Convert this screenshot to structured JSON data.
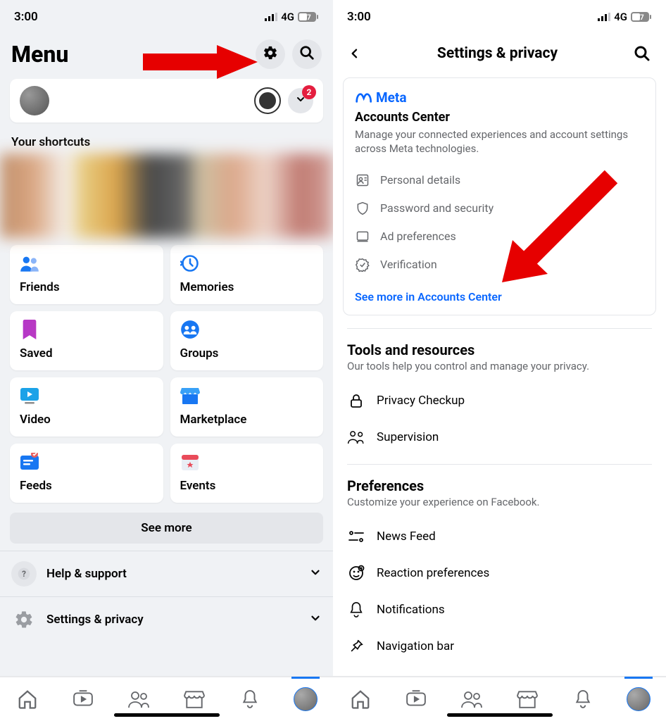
{
  "status": {
    "time": "3:00",
    "network": "4G",
    "battery": "47"
  },
  "left": {
    "title": "Menu",
    "notif_badge": "2",
    "shortcuts_label": "Your shortcuts",
    "tiles": [
      {
        "label": "Friends"
      },
      {
        "label": "Memories"
      },
      {
        "label": "Saved"
      },
      {
        "label": "Groups"
      },
      {
        "label": "Video"
      },
      {
        "label": "Marketplace"
      },
      {
        "label": "Feeds"
      },
      {
        "label": "Events"
      }
    ],
    "see_more": "See more",
    "menu": [
      {
        "label": "Help & support"
      },
      {
        "label": "Settings & privacy"
      }
    ]
  },
  "right": {
    "title": "Settings & privacy",
    "meta": {
      "brand": "Meta",
      "heading": "Accounts Center",
      "sub": "Manage your connected experiences and account settings across Meta technologies.",
      "items": [
        {
          "label": "Personal details"
        },
        {
          "label": "Password and security"
        },
        {
          "label": "Ad preferences"
        },
        {
          "label": "Verification"
        }
      ],
      "link": "See more in Accounts Center"
    },
    "tools": {
      "heading": "Tools and resources",
      "sub": "Our tools help you control and manage your privacy.",
      "items": [
        {
          "label": "Privacy Checkup"
        },
        {
          "label": "Supervision"
        }
      ]
    },
    "prefs": {
      "heading": "Preferences",
      "sub": "Customize your experience on Facebook.",
      "items": [
        {
          "label": "News Feed"
        },
        {
          "label": "Reaction preferences"
        },
        {
          "label": "Notifications"
        },
        {
          "label": "Navigation bar"
        }
      ]
    }
  }
}
